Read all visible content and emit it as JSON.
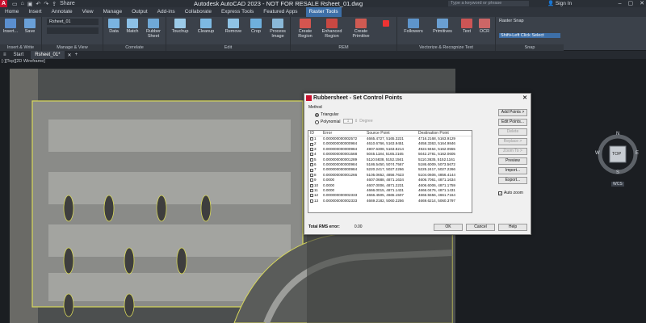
{
  "app": {
    "logo": "A",
    "title": "Autodesk AutoCAD 2023 - NOT FOR RESALE   Rsheet_01.dwg",
    "share": "Share",
    "search_placeholder": "Type a keyword or phrase",
    "signin": "Sign In"
  },
  "ribbon_tabs": [
    "Home",
    "Insert",
    "Annotate",
    "View",
    "Manage",
    "Output",
    "Add-ins",
    "Collaborate",
    "Express Tools",
    "Featured Apps",
    "Raster Tools"
  ],
  "active_tab": "Raster Tools",
  "ribbon": {
    "insert_write": {
      "label": "Insert & Write",
      "insert": "Insert...",
      "save": "Save"
    },
    "manage_view": {
      "label": "Manage & View",
      "image_name": "Rsheet_01"
    },
    "correlate": {
      "label": "Correlate",
      "data": "Data",
      "match": "Match",
      "rubbersheet": "Rubber Sheet"
    },
    "edit": {
      "label": "Edit",
      "touchup": "Touchup",
      "cleanup": "Cleanup",
      "remove": "Remove",
      "crop": "Crop",
      "process": "Process Image"
    },
    "rem": {
      "label": "REM",
      "create_region": "Create Region",
      "enhanced_region": "Enhanced Region",
      "create_primitive": "Create Primitive"
    },
    "vectorize": {
      "label": "Vectorize & Recognize Text",
      "followers": "Followers",
      "primitives": "Primitives",
      "text": "Text",
      "ocr": "OCR"
    },
    "snap": {
      "label": "Snap",
      "raster_snap": "Raster Snap",
      "shift_left": "Shift+Left Click Select"
    }
  },
  "file_tabs": [
    "Start",
    "Rsheet_01*"
  ],
  "view_label": "[-][Top][2D Wireframe]",
  "viewcube": {
    "top": "TOP",
    "n": "N",
    "s": "S",
    "e": "E",
    "w": "W",
    "wcs": "WCS"
  },
  "dialog": {
    "title": "Rubbersheet - Set Control Points",
    "method_label": "Method",
    "triangular": "Triangular",
    "polynomial": "Polynomial",
    "degree_value": "1",
    "degree_label": "Degree",
    "columns": [
      "ID",
      "Error",
      "Source Point",
      "Destination Point"
    ],
    "rows": [
      {
        "id": "1",
        "error": "0.000000000002572",
        "src": "4665.4727, 5165.3221",
        "dst": "4716.2168, 5163.9129"
      },
      {
        "id": "2",
        "error": "0.000000000000984",
        "src": "4610.6766, 5163.9451",
        "dst": "4658.3363, 5164.9846"
      },
      {
        "id": "3",
        "error": "0.000000000000984",
        "src": "4907.6308, 5163.8214",
        "dst": "4924.9464, 5162.0555"
      },
      {
        "id": "4",
        "error": "0.000000000001568",
        "src": "5045.1184, 5165.2165",
        "dst": "5042.2781, 5162.0605"
      },
      {
        "id": "5",
        "error": "0.000000000001289",
        "src": "5110.5838, 5152.1561",
        "dst": "5110.3635, 5152.1161"
      },
      {
        "id": "6",
        "error": "0.000000000000984",
        "src": "5186.5450, 5074.7567",
        "dst": "5186.6009, 5073.5672"
      },
      {
        "id": "7",
        "error": "0.000000000000984",
        "src": "5220.2417, 5027.2266",
        "dst": "5225.2417, 5027.2266"
      },
      {
        "id": "8",
        "error": "0.000000000001266",
        "src": "5105.0652, 4856.7623",
        "dst": "5104.0606, 4856.4144"
      },
      {
        "id": "9",
        "error": "0.0000",
        "src": "4607.0688, 4871.1634",
        "dst": "4606.7061, 4871.1634"
      },
      {
        "id": "10",
        "error": "0.0000",
        "src": "4607.0006, 4871.2231",
        "dst": "4606.6006, 4871.1759"
      },
      {
        "id": "11",
        "error": "0.0000",
        "src": "4666.0015, 4871.1431",
        "dst": "4666.0476, 4871.1431"
      },
      {
        "id": "12",
        "error": "0.000000000002333",
        "src": "4666.4505, 4665.1507",
        "dst": "4666.5556, 4661.7164"
      },
      {
        "id": "13",
        "error": "0.000000000002333",
        "src": "4669.2182, 5060.2256",
        "dst": "4669.6214, 5060.3797"
      }
    ],
    "buttons": {
      "add_points": "Add Points >",
      "edit_points": "Edit Points...",
      "delete": "Delete",
      "replace": "Replace >",
      "zoom_to": "Zoom To >",
      "preview": "Preview",
      "import": "Import...",
      "export": "Export...",
      "ok": "OK",
      "cancel": "Cancel",
      "help": "Help"
    },
    "auto_zoom": "Auto zoom",
    "rms_label": "Total RMS error:",
    "rms_value": "0.00"
  }
}
